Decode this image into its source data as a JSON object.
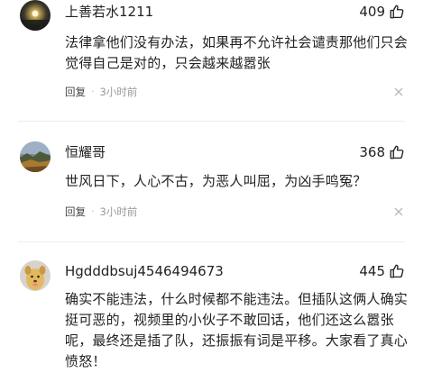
{
  "comments": [
    {
      "username": "上善若水1211",
      "likes": "409",
      "text": "法律拿他们没有办法，如果再不允许社会谴责那他们只会觉得自己是对的，只会越来越嚣张",
      "reply_label": "回复",
      "separator": "·",
      "time": "3小时前",
      "avatar_icon": "sunset-avatar-icon"
    },
    {
      "username": "恒耀哥",
      "likes": "368",
      "text": "世风日下，人心不古，为恶人叫屈，为凶手鸣冤？",
      "reply_label": "回复",
      "separator": "·",
      "time": "3小时前",
      "avatar_icon": "landscape-avatar-icon"
    },
    {
      "username": "Hgdddbsuj4546494673",
      "likes": "445",
      "text": "确实不能违法，什么时候都不能违法。但插队这俩人确实挺可恶的，视频里的小伙子不敢回话，他们还这么嚣张呢，最终还是插了队，还振振有词是平移。大家看了真心愤怒！",
      "avatar_icon": "cartoon-dog-avatar-icon"
    }
  ],
  "icons": {
    "like": "thumbs-up-icon",
    "close": "close-icon"
  },
  "colors": {
    "text": "#222222",
    "meta": "#999999",
    "divider": "#ececec"
  }
}
